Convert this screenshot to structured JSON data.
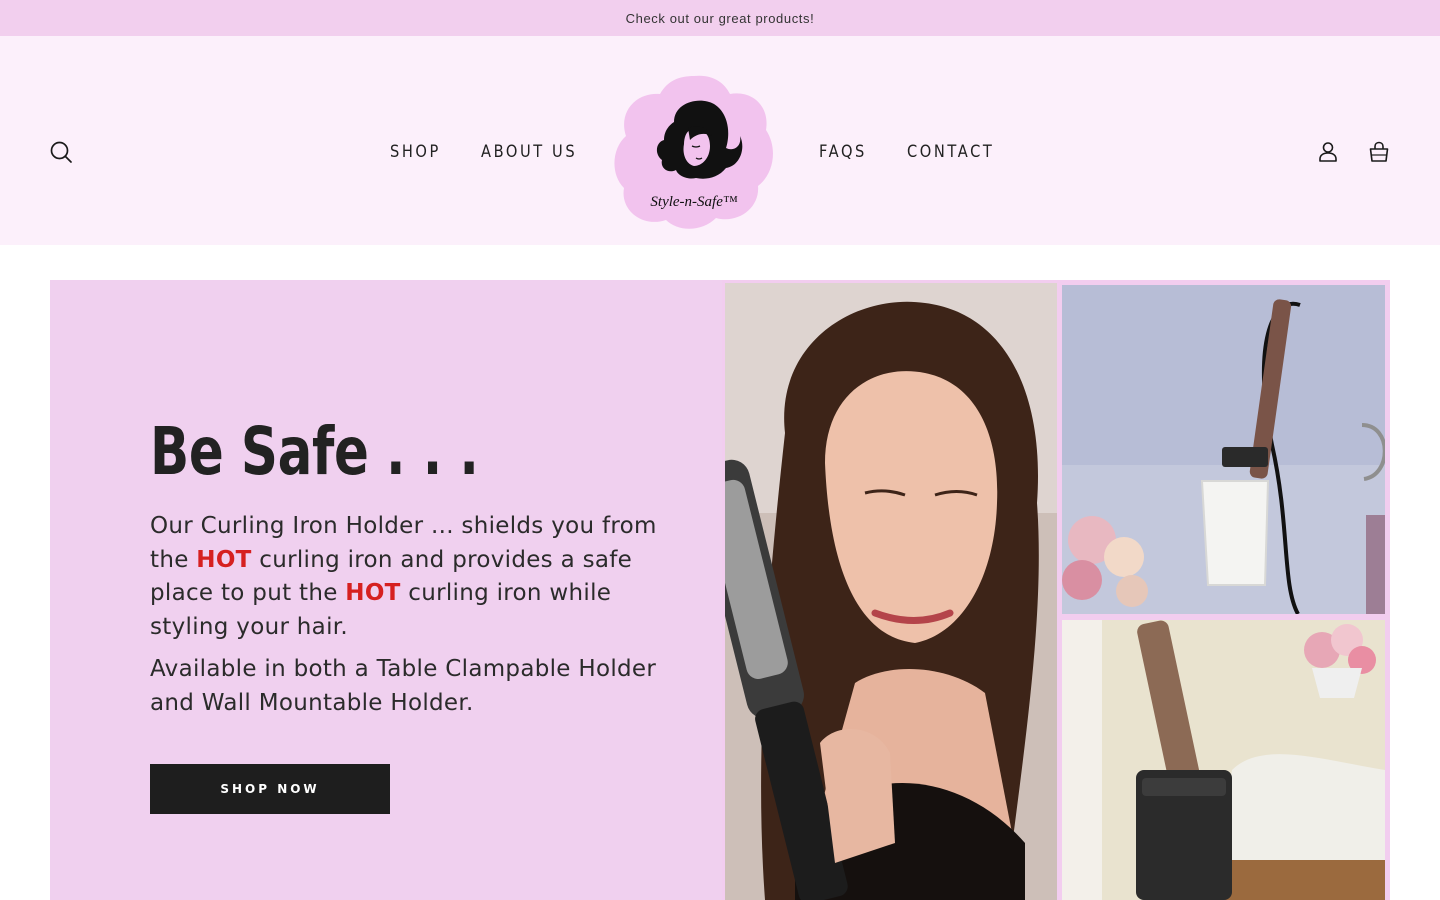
{
  "announcement": {
    "text": "Check out our great products!"
  },
  "header": {
    "nav_left": [
      {
        "label": "SHOP"
      },
      {
        "label": "ABOUT US"
      }
    ],
    "nav_right": [
      {
        "label": "FAQS"
      },
      {
        "label": "CONTACT"
      }
    ],
    "logo": {
      "wordmark": "Style-n-Safe™"
    },
    "icons": {
      "search": "search-icon",
      "account": "user-icon",
      "cart": "shopping-bag-icon"
    }
  },
  "hero": {
    "heading": "Be Safe . . .",
    "paragraph1": {
      "part1": "Our Curling Iron Holder ... shields you from the ",
      "hot1": "HOT",
      "part2": " curling iron and provides a safe place to put the ",
      "hot2": "HOT",
      "part3": " curling iron while styling your hair."
    },
    "paragraph2": "Available in both a Table Clampable Holder and Wall Mountable Holder.",
    "cta_label": "SHOP NOW"
  },
  "colors": {
    "announcement_bg": "#f2cfee",
    "header_bg": "#fcf0fb",
    "hero_bg": "#f0d0ef",
    "hot_text": "#d62020",
    "button_bg": "#1e1e1e"
  }
}
